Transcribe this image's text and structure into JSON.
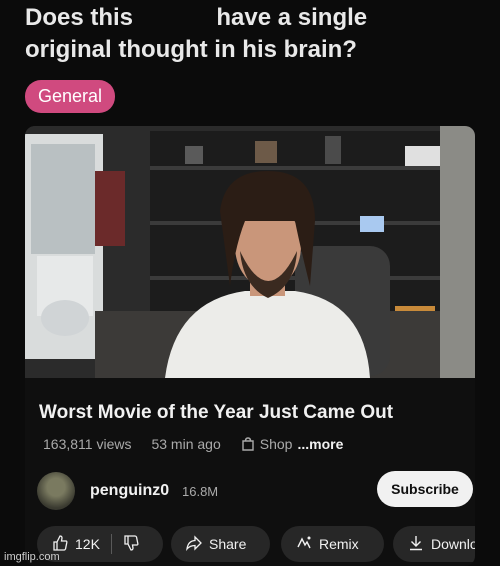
{
  "post": {
    "title_part1": "Does this",
    "title_part2": "have a single",
    "title_line2": "original thought in his brain?",
    "flair": "General"
  },
  "video": {
    "title": "Worst Movie of the Year Just Came Out",
    "views": "163,811 views",
    "age": "53 min ago",
    "shop": "Shop",
    "more": "...more",
    "channel": "penguinz0",
    "subscribers": "16.8M",
    "subscribe_label": "Subscribe"
  },
  "actions": {
    "likes": "12K",
    "share": "Share",
    "remix": "Remix",
    "download": "Download"
  },
  "watermark": "imgflip.com",
  "colors": {
    "flair_bg": "#d04a7f",
    "pill_bg": "#272727",
    "page_bg": "#0b0b0b"
  },
  "icons": [
    "like-icon",
    "dislike-icon",
    "share-icon",
    "remix-icon",
    "download-icon",
    "shop-icon"
  ]
}
